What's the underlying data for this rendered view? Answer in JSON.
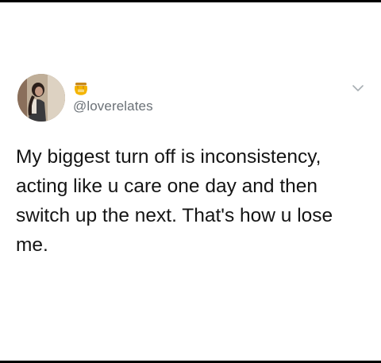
{
  "tweet": {
    "handle": "@loverelates",
    "text": "My biggest turn off is inconsistency, acting like u care one day and then switch up the next. That's how u lose me.",
    "name_emoji": "honey-pot-icon",
    "menu_icon": "chevron-down-icon"
  },
  "colors": {
    "background": "#ffffff",
    "text": "#141414",
    "handle": "#6b7177",
    "chevron": "#a8aeb3",
    "honey": "#f4b400"
  }
}
